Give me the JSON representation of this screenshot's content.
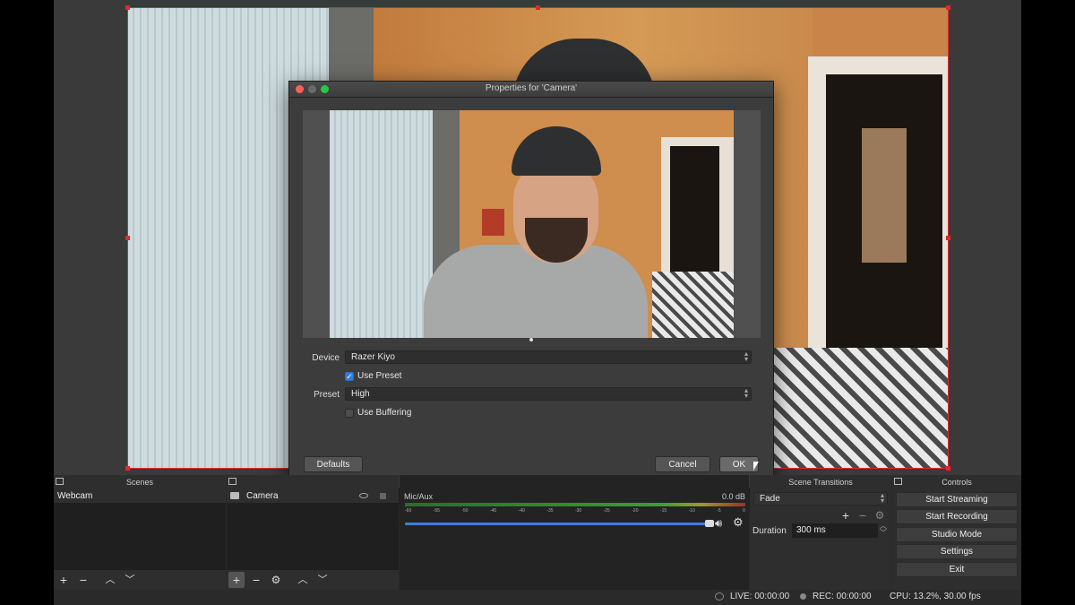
{
  "dialog": {
    "title": "Properties for 'Camera'",
    "device_label": "Device",
    "device_value": "Razer Kiyo",
    "use_preset_label": "Use Preset",
    "use_preset_checked": true,
    "preset_label": "Preset",
    "preset_value": "High",
    "use_buffering_label": "Use Buffering",
    "use_buffering_checked": false,
    "defaults_button": "Defaults",
    "cancel_button": "Cancel",
    "ok_button": "OK"
  },
  "scenes": {
    "title": "Scenes",
    "items": [
      "Webcam"
    ]
  },
  "sources": {
    "items": [
      "Camera"
    ]
  },
  "mixer": {
    "channel_name": "Mic/Aux",
    "level": "0.0 dB",
    "ticks": [
      "-60",
      "-55",
      "-50",
      "-45",
      "-40",
      "-35",
      "-30",
      "-25",
      "-20",
      "-15",
      "-10",
      "-5",
      "0"
    ]
  },
  "transitions": {
    "title": "Scene Transitions",
    "selected": "Fade",
    "duration_label": "Duration",
    "duration_value": "300 ms"
  },
  "controls": {
    "title": "Controls",
    "buttons": [
      "Start Streaming",
      "Start Recording",
      "Studio Mode",
      "Settings",
      "Exit"
    ]
  },
  "status": {
    "live": "LIVE: 00:00:00",
    "rec": "REC: 00:00:00",
    "cpu": "CPU: 13.2%, 30.00 fps"
  },
  "colors": {
    "accent_red": "#e0292a",
    "checkbox_blue": "#2f7ee6",
    "meter_green": "#3e9a3a",
    "volume_blue": "#3f7fd8"
  },
  "icons": [
    "eye-icon",
    "lock-icon",
    "plus-icon",
    "minus-icon",
    "gear-icon",
    "up-arrow-icon",
    "down-arrow-icon",
    "speaker-icon",
    "camera-source-icon",
    "dock-float-icon"
  ]
}
